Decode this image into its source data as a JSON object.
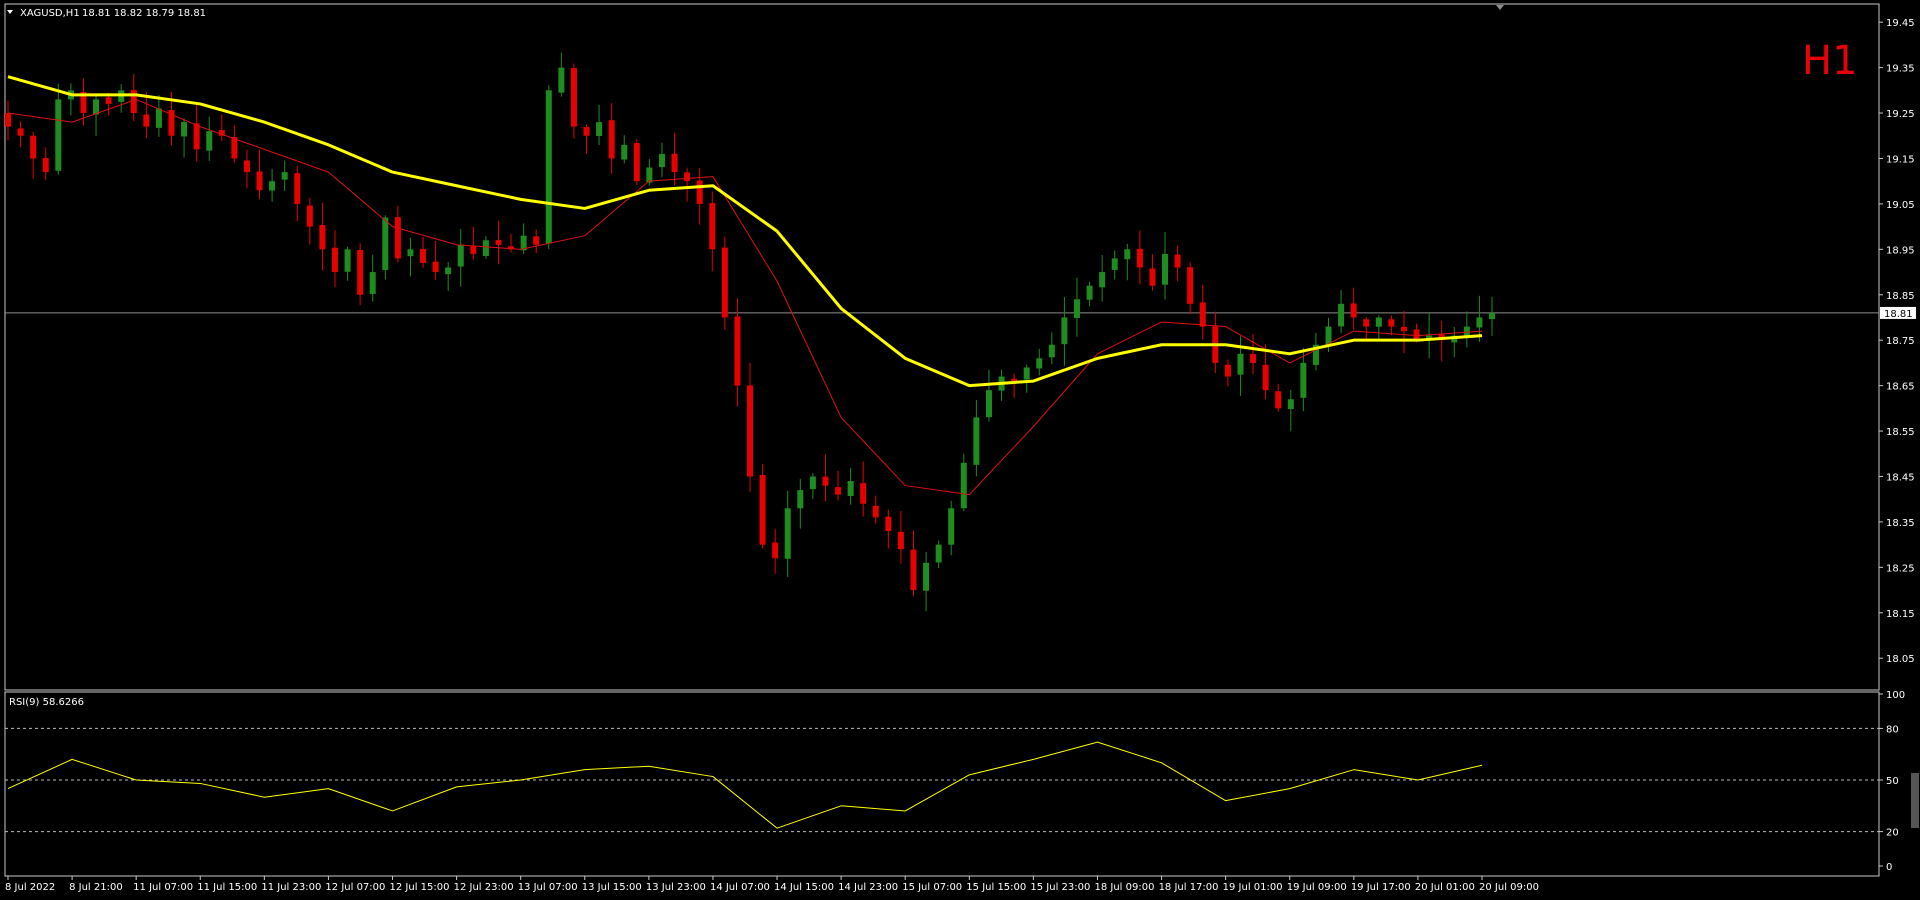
{
  "header": {
    "symbol": "XAGUSD,H1",
    "ohlc": "18.81 18.82 18.79 18.81",
    "timeframe_badge": "H1"
  },
  "rsi_label": "RSI(9) 58.6266",
  "colors": {
    "background": "#000000",
    "bull": "#1e8c1e",
    "bear": "#e60000",
    "ma_slow": "#ffff00",
    "ma_fast": "#dd1111",
    "rsi": "#ffff00",
    "badge": "#e8000a"
  },
  "chart_data": [
    {
      "type": "candlestick",
      "title": "XAGUSD,H1",
      "ylim": [
        17.98,
        19.49
      ],
      "yticks": [
        19.45,
        19.35,
        19.25,
        19.15,
        19.05,
        18.95,
        18.85,
        18.75,
        18.65,
        18.55,
        18.45,
        18.35,
        18.25,
        18.15,
        18.05
      ],
      "x_labels": [
        "8 Jul 2022",
        "8 Jul 21:00",
        "11 Jul 07:00",
        "11 Jul 15:00",
        "11 Jul 23:00",
        "12 Jul 07:00",
        "12 Jul 15:00",
        "12 Jul 23:00",
        "13 Jul 07:00",
        "13 Jul 15:00",
        "13 Jul 23:00",
        "14 Jul 07:00",
        "14 Jul 15:00",
        "14 Jul 23:00",
        "15 Jul 07:00",
        "15 Jul 15:00",
        "15 Jul 23:00",
        "18 Jul 09:00",
        "18 Jul 17:00",
        "19 Jul 01:00",
        "19 Jul 09:00",
        "19 Jul 17:00",
        "20 Jul 01:00",
        "20 Jul 09:00"
      ],
      "current_price": 18.81,
      "close_path": [
        19.22,
        19.2,
        19.15,
        19.12,
        19.28,
        19.3,
        19.25,
        19.28,
        19.27,
        19.3,
        19.25,
        19.22,
        19.26,
        19.2,
        19.23,
        19.17,
        19.21,
        19.2,
        19.15,
        19.12,
        19.08,
        19.1,
        19.12,
        19.05,
        19.0,
        18.95,
        18.9,
        18.95,
        18.85,
        18.9,
        19.02,
        18.93,
        18.95,
        18.92,
        18.9,
        18.91,
        18.96,
        18.94,
        18.97,
        18.96,
        18.95,
        18.98,
        18.96,
        19.3,
        19.35,
        19.22,
        19.2,
        19.23,
        19.15,
        19.18,
        19.1,
        19.13,
        19.16,
        19.12,
        19.1,
        19.05,
        18.95,
        18.8,
        18.65,
        18.45,
        18.3,
        18.27,
        18.38,
        18.42,
        18.45,
        18.43,
        18.41,
        18.44,
        18.39,
        18.36,
        18.33,
        18.29,
        18.2,
        18.26,
        18.3,
        18.38,
        18.48,
        18.58,
        18.64,
        18.67,
        18.66,
        18.69,
        18.71,
        18.74,
        18.8,
        18.84,
        18.87,
        18.9,
        18.93,
        18.95,
        18.91,
        18.87,
        18.94,
        18.91,
        18.83,
        18.78,
        18.7,
        18.67,
        18.72,
        18.7,
        18.64,
        18.6,
        18.62,
        18.7,
        18.74,
        18.78,
        18.83,
        18.8,
        18.78,
        18.8,
        18.78,
        18.77,
        18.75,
        18.76,
        18.75,
        18.76,
        18.78,
        18.8,
        18.81
      ],
      "ma_slow": [
        {
          "x": "8 Jul 2022",
          "y": 19.33
        },
        {
          "x": "8 Jul 21:00",
          "y": 19.29
        },
        {
          "x": "11 Jul 07:00",
          "y": 19.29
        },
        {
          "x": "11 Jul 15:00",
          "y": 19.27
        },
        {
          "x": "11 Jul 23:00",
          "y": 19.23
        },
        {
          "x": "12 Jul 07:00",
          "y": 19.18
        },
        {
          "x": "12 Jul 15:00",
          "y": 19.12
        },
        {
          "x": "12 Jul 23:00",
          "y": 19.09
        },
        {
          "x": "13 Jul 07:00",
          "y": 19.06
        },
        {
          "x": "13 Jul 15:00",
          "y": 19.04
        },
        {
          "x": "13 Jul 23:00",
          "y": 19.08
        },
        {
          "x": "14 Jul 07:00",
          "y": 19.09
        },
        {
          "x": "14 Jul 15:00",
          "y": 18.99
        },
        {
          "x": "14 Jul 23:00",
          "y": 18.82
        },
        {
          "x": "15 Jul 07:00",
          "y": 18.71
        },
        {
          "x": "15 Jul 15:00",
          "y": 18.65
        },
        {
          "x": "15 Jul 23:00",
          "y": 18.66
        },
        {
          "x": "18 Jul 09:00",
          "y": 18.71
        },
        {
          "x": "18 Jul 17:00",
          "y": 18.74
        },
        {
          "x": "19 Jul 01:00",
          "y": 18.74
        },
        {
          "x": "19 Jul 09:00",
          "y": 18.72
        },
        {
          "x": "19 Jul 17:00",
          "y": 18.75
        },
        {
          "x": "20 Jul 01:00",
          "y": 18.75
        },
        {
          "x": "20 Jul 09:00",
          "y": 18.76
        }
      ],
      "ma_fast": [
        {
          "x": "8 Jul 2022",
          "y": 19.25
        },
        {
          "x": "8 Jul 21:00",
          "y": 19.23
        },
        {
          "x": "11 Jul 07:00",
          "y": 19.28
        },
        {
          "x": "11 Jul 15:00",
          "y": 19.22
        },
        {
          "x": "11 Jul 23:00",
          "y": 19.17
        },
        {
          "x": "12 Jul 07:00",
          "y": 19.12
        },
        {
          "x": "12 Jul 15:00",
          "y": 19.0
        },
        {
          "x": "12 Jul 23:00",
          "y": 18.96
        },
        {
          "x": "13 Jul 07:00",
          "y": 18.95
        },
        {
          "x": "13 Jul 15:00",
          "y": 18.98
        },
        {
          "x": "13 Jul 23:00",
          "y": 19.1
        },
        {
          "x": "14 Jul 07:00",
          "y": 19.11
        },
        {
          "x": "14 Jul 15:00",
          "y": 18.88
        },
        {
          "x": "14 Jul 23:00",
          "y": 18.58
        },
        {
          "x": "15 Jul 07:00",
          "y": 18.43
        },
        {
          "x": "15 Jul 15:00",
          "y": 18.41
        },
        {
          "x": "15 Jul 23:00",
          "y": 18.56
        },
        {
          "x": "18 Jul 09:00",
          "y": 18.72
        },
        {
          "x": "18 Jul 17:00",
          "y": 18.79
        },
        {
          "x": "19 Jul 01:00",
          "y": 18.78
        },
        {
          "x": "19 Jul 09:00",
          "y": 18.7
        },
        {
          "x": "19 Jul 17:00",
          "y": 18.77
        },
        {
          "x": "20 Jul 01:00",
          "y": 18.76
        },
        {
          "x": "20 Jul 09:00",
          "y": 18.77
        }
      ]
    },
    {
      "type": "line",
      "title": "RSI(9) 58.6266",
      "ylim": [
        0,
        100
      ],
      "yticks": [
        100,
        80,
        50,
        20,
        0
      ],
      "levels": [
        80,
        50,
        20
      ],
      "rsi": [
        {
          "x": "8 Jul 2022",
          "y": 45
        },
        {
          "x": "8 Jul 21:00",
          "y": 62
        },
        {
          "x": "11 Jul 07:00",
          "y": 50
        },
        {
          "x": "11 Jul 15:00",
          "y": 48
        },
        {
          "x": "11 Jul 23:00",
          "y": 40
        },
        {
          "x": "12 Jul 07:00",
          "y": 45
        },
        {
          "x": "12 Jul 15:00",
          "y": 32
        },
        {
          "x": "12 Jul 23:00",
          "y": 46
        },
        {
          "x": "13 Jul 07:00",
          "y": 50
        },
        {
          "x": "13 Jul 15:00",
          "y": 56
        },
        {
          "x": "13 Jul 23:00",
          "y": 58
        },
        {
          "x": "14 Jul 07:00",
          "y": 52
        },
        {
          "x": "14 Jul 15:00",
          "y": 22
        },
        {
          "x": "14 Jul 23:00",
          "y": 35
        },
        {
          "x": "15 Jul 07:00",
          "y": 32
        },
        {
          "x": "15 Jul 15:00",
          "y": 53
        },
        {
          "x": "15 Jul 23:00",
          "y": 62
        },
        {
          "x": "18 Jul 09:00",
          "y": 72
        },
        {
          "x": "18 Jul 17:00",
          "y": 60
        },
        {
          "x": "19 Jul 01:00",
          "y": 38
        },
        {
          "x": "19 Jul 09:00",
          "y": 45
        },
        {
          "x": "19 Jul 17:00",
          "y": 56
        },
        {
          "x": "20 Jul 01:00",
          "y": 50
        },
        {
          "x": "20 Jul 09:00",
          "y": 58.6
        }
      ]
    }
  ]
}
